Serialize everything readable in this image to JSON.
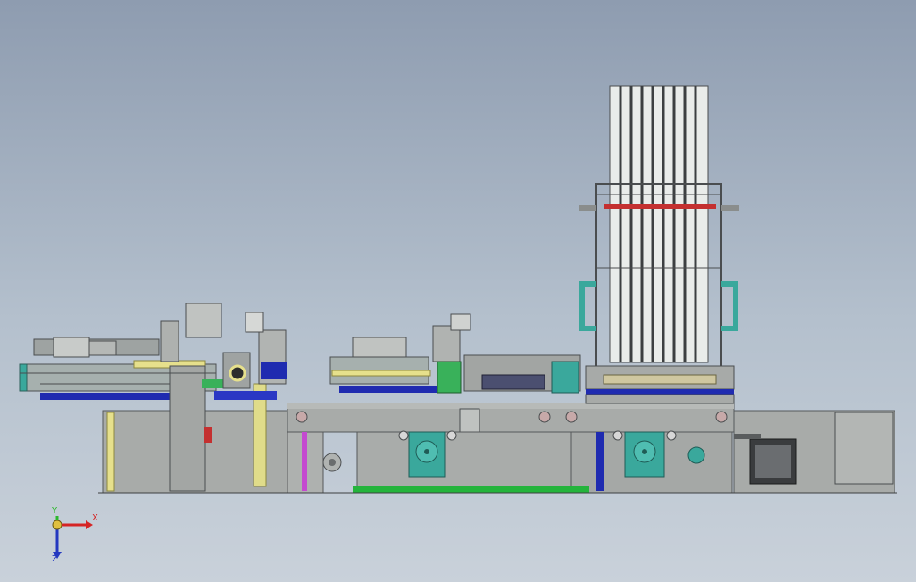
{
  "viewport": {
    "background_top": "#8e9cb0",
    "background_bottom": "#c9d1da"
  },
  "colors": {
    "frame": "#a9acaa",
    "frame_dark": "#5a5d5e",
    "accent_blue": "#1f2bb0",
    "accent_yellow": "#e6e08c",
    "accent_teal": "#43a59c",
    "accent_green": "#24b43c",
    "accent_red": "#c43030",
    "axis_x": "#d52424",
    "axis_y": "#2cb82c",
    "axis_z": "#2438c0"
  },
  "triad": {
    "x_label": "X",
    "y_label": "Y",
    "z_label": "Z"
  }
}
